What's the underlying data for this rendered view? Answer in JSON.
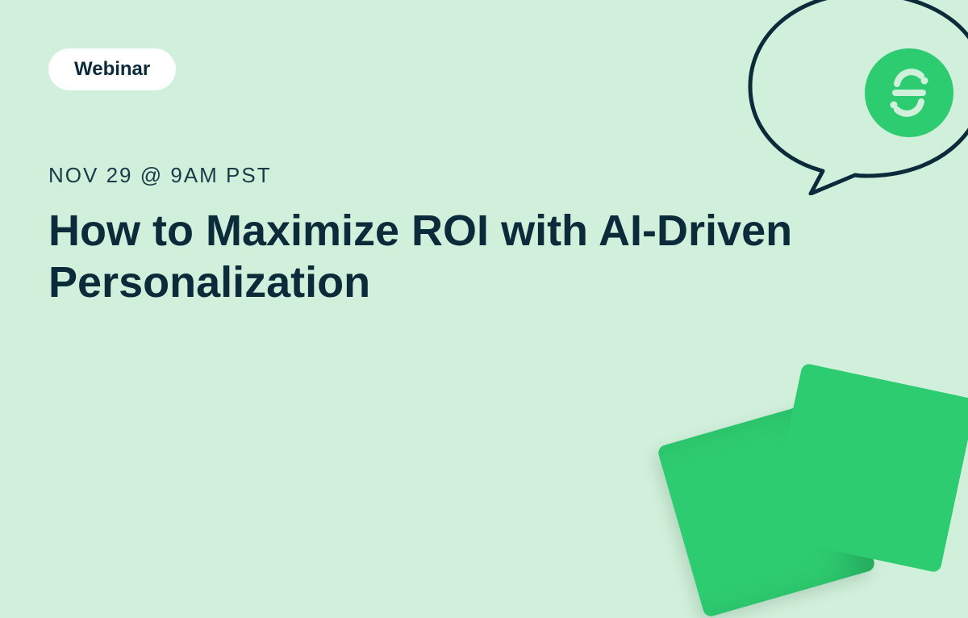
{
  "badge": {
    "label": "Webinar"
  },
  "event": {
    "datetime": "NOV 29 @ 9AM PST",
    "title": "How to Maximize ROI with AI-Driven Personalization"
  },
  "colors": {
    "background": "#d0f0db",
    "accent": "#2ecc71",
    "text_dark": "#0b2a3a",
    "text_muted": "#1a3a47",
    "badge_bg": "#ffffff"
  }
}
